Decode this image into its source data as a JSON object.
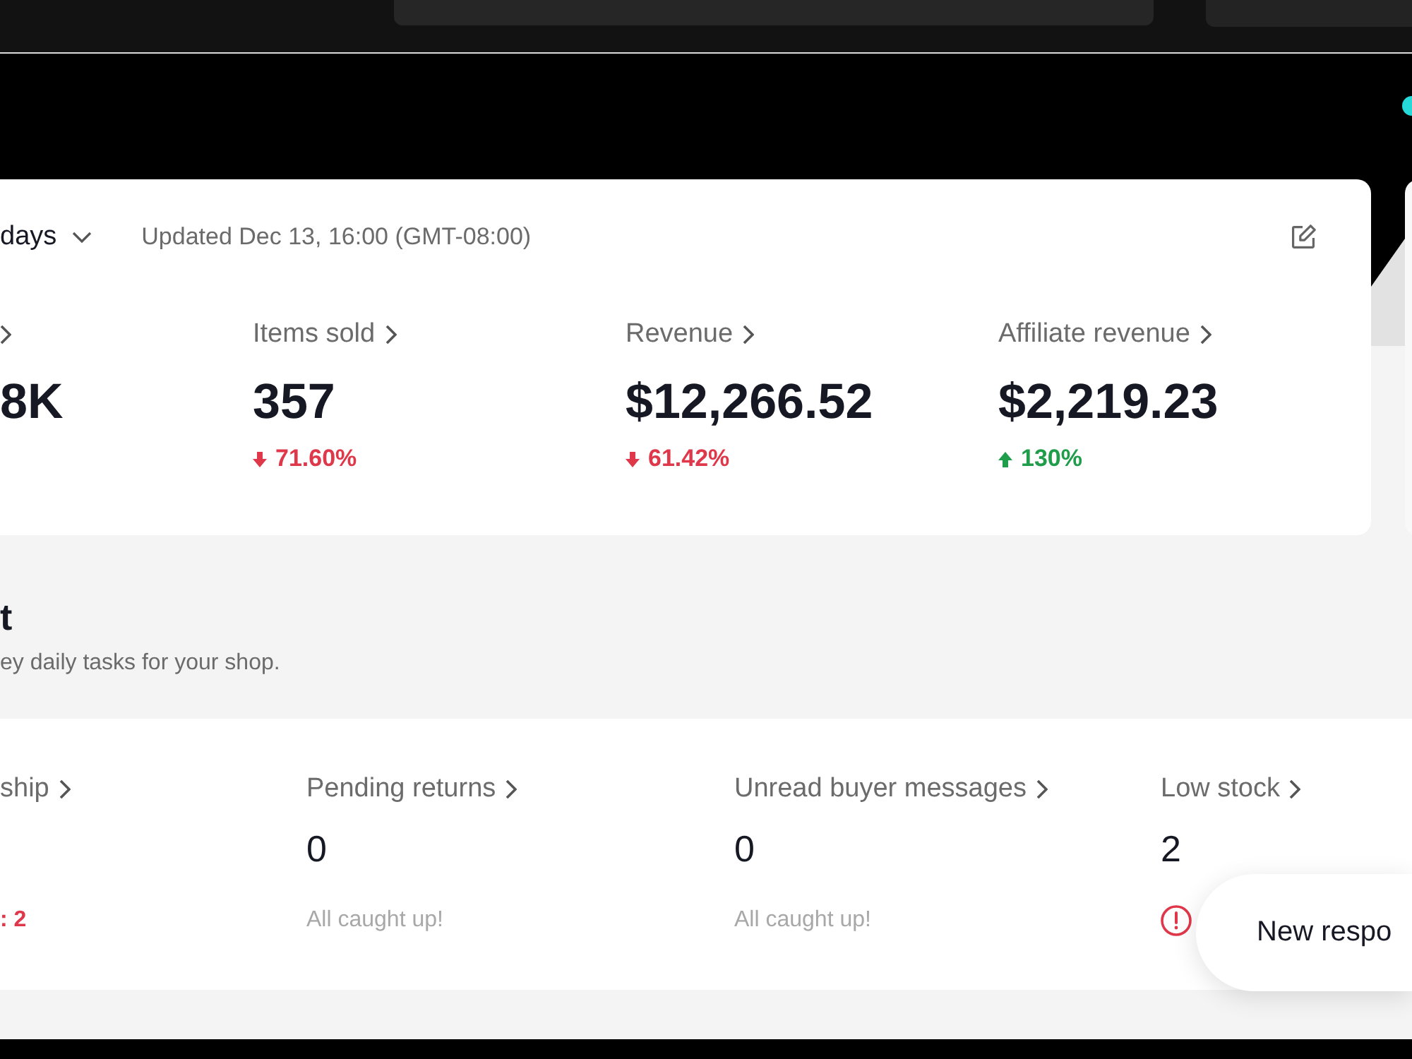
{
  "overview": {
    "range": "days",
    "updated": "Updated Dec 13, 16:00 (GMT-08:00)",
    "metrics": [
      {
        "value": "8K"
      },
      {
        "label": "Items sold",
        "value": "357",
        "change": "71.60%",
        "increase": false
      },
      {
        "label": "Revenue",
        "value": "$12,266.52",
        "change": "61.42%",
        "increase": false
      },
      {
        "label": "Affiliate revenue",
        "value": "$2,219.23",
        "change": "130%",
        "increase": true
      }
    ]
  },
  "tasks": {
    "heading": "t",
    "subtitle": "ey daily tasks for your shop.",
    "items": [
      {
        "label": "ship",
        "status": {
          "alert": true,
          "icon": false,
          "text": ": 2"
        }
      },
      {
        "label": "Pending returns",
        "value": "0",
        "status": {
          "alert": false,
          "icon": false,
          "text": "All caught up!"
        }
      },
      {
        "label": "Unread buyer messages",
        "value": "0",
        "status": {
          "alert": false,
          "icon": false,
          "text": "All caught up!"
        }
      },
      {
        "label": "Low stock",
        "value": "2",
        "status": {
          "alert": true,
          "icon": true
        }
      }
    ]
  },
  "toast": {
    "text": "New respo"
  }
}
